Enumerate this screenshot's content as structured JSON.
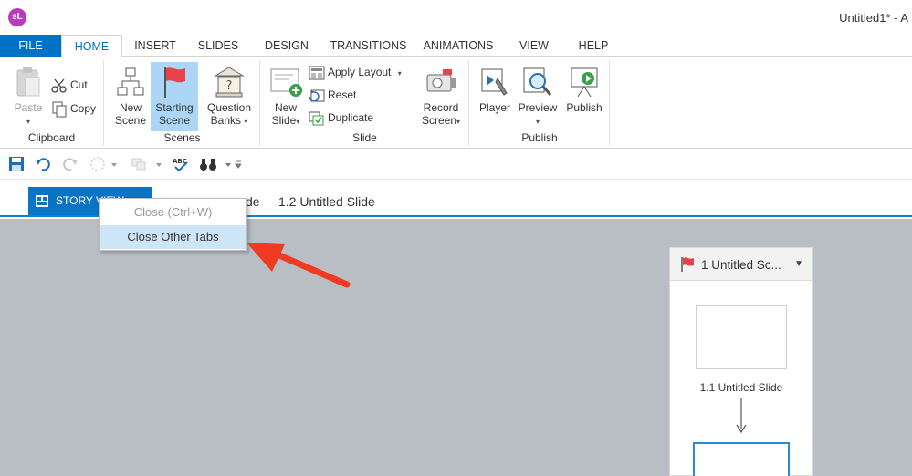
{
  "app": {
    "logo_text": "sL",
    "window_title": "Untitled1* - A"
  },
  "ribbon_tabs": [
    "FILE",
    "HOME",
    "INSERT",
    "SLIDES",
    "DESIGN",
    "TRANSITIONS",
    "ANIMATIONS",
    "VIEW",
    "HELP"
  ],
  "active_tab": "HOME",
  "ribbon": {
    "clipboard": {
      "label": "Clipboard",
      "paste": "Paste",
      "cut": "Cut",
      "copy": "Copy"
    },
    "scenes": {
      "label": "Scenes",
      "new_scene_1": "New",
      "new_scene_2": "Scene",
      "starting_1": "Starting",
      "starting_2": "Scene",
      "qbanks_1": "Question",
      "qbanks_2": "Banks"
    },
    "slide": {
      "label": "Slide",
      "new_slide_1": "New",
      "new_slide_2": "Slide",
      "apply_layout": "Apply Layout",
      "reset": "Reset",
      "duplicate": "Duplicate",
      "record_1": "Record",
      "record_2": "Screen"
    },
    "publish": {
      "label": "Publish",
      "player": "Player",
      "preview": "Preview",
      "publish": "Publish"
    }
  },
  "story_tabs": {
    "story_view": "STORY VIEW",
    "tab_partial": "de",
    "tab_slide": "1.2 Untitled Slide"
  },
  "context_menu": {
    "close": "Close (Ctrl+W)",
    "close_others": "Close Other Tabs"
  },
  "scene_panel": {
    "title": "1 Untitled Sc...",
    "slide_label": "1.1 Untitled Slide"
  },
  "colors": {
    "accent": "#0072c6",
    "canvas": "#b9bec5",
    "flag": "#e8434a",
    "arrow": "#f03a22",
    "highlight": "#cde6f7"
  }
}
